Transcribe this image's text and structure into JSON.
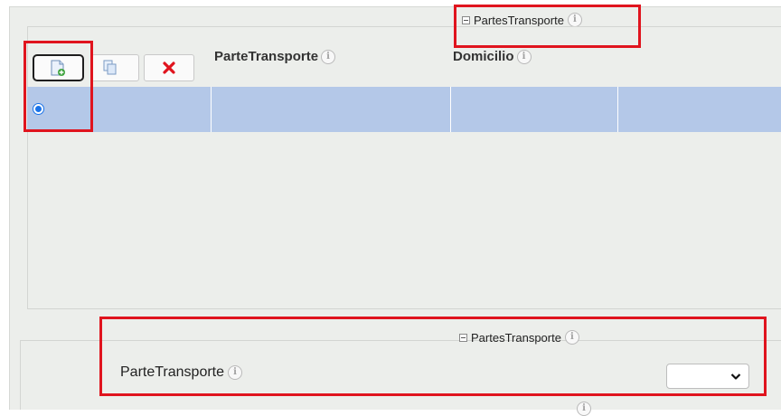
{
  "group": {
    "legend_title": "PartesTransporte"
  },
  "toolbar": {
    "add_icon": "add-document-icon",
    "copy_icon": "copy-icon",
    "delete_icon": "delete-x-icon"
  },
  "table": {
    "columns": [
      {
        "label": "ParteTransporte"
      },
      {
        "label": "Domicilio"
      }
    ]
  },
  "detail": {
    "legend_title": "PartesTransporte",
    "field_label": "ParteTransporte",
    "select_value": ""
  },
  "colors": {
    "highlight": "#e0141e",
    "selected_row": "#b4c8e8",
    "radio": "#1a73e8",
    "delete": "#e0141e"
  }
}
